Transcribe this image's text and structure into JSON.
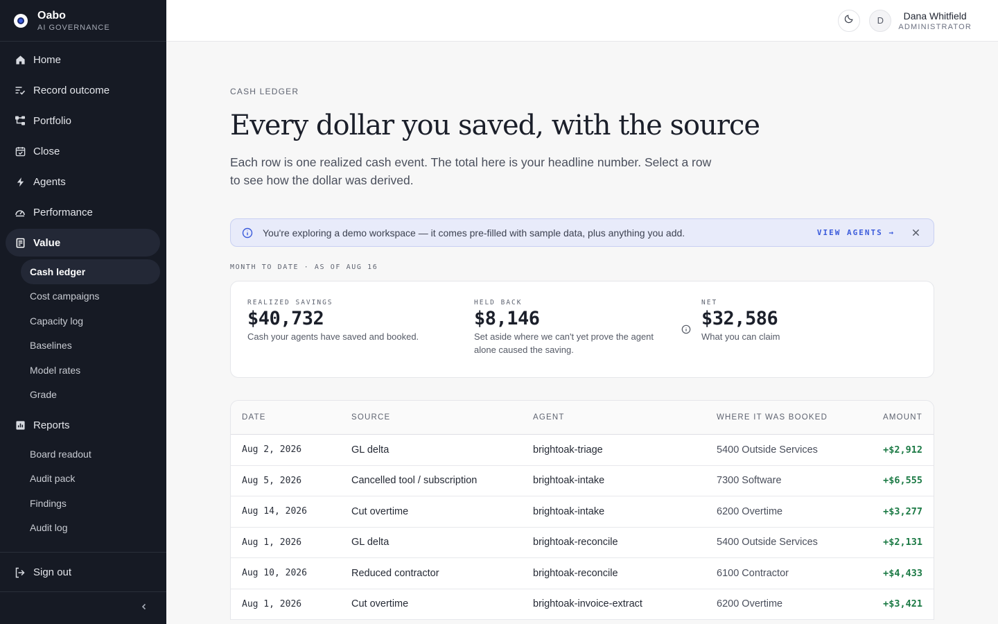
{
  "brand": {
    "name": "Oabo",
    "subtitle": "AI GOVERNANCE"
  },
  "nav": {
    "home": "Home",
    "record_outcome": "Record outcome",
    "portfolio": "Portfolio",
    "close": "Close",
    "agents": "Agents",
    "performance": "Performance",
    "value": "Value",
    "value_items": [
      "Cash ledger",
      "Cost campaigns",
      "Capacity log",
      "Baselines",
      "Model rates",
      "Grade"
    ],
    "reports": "Reports",
    "report_items": [
      "Board readout",
      "Audit pack",
      "Findings",
      "Audit log"
    ],
    "sign_out": "Sign out"
  },
  "user": {
    "initial": "D",
    "name": "Dana Whitfield",
    "role": "ADMINISTRATOR"
  },
  "page": {
    "eyebrow": "CASH LEDGER",
    "title": "Every dollar you saved, with the source",
    "lede": "Each row is one realized cash event. The total here is your headline number. Select a row to see how the dollar was derived."
  },
  "banner": {
    "text": "You're exploring a demo workspace — it comes pre-filled with sample data, plus anything you add.",
    "link": "VIEW AGENTS →"
  },
  "period": "MONTH TO DATE · AS OF AUG 16",
  "summary": {
    "realized": {
      "label": "REALIZED SAVINGS",
      "value": "$40,732",
      "desc": "Cash your agents have saved and booked."
    },
    "held": {
      "label": "HELD BACK",
      "value": "$8,146",
      "desc": "Set aside where we can't yet prove the agent alone caused the saving."
    },
    "net": {
      "label": "NET",
      "value": "$32,586",
      "desc": "What you can claim"
    }
  },
  "table": {
    "headers": {
      "date": "DATE",
      "source": "SOURCE",
      "agent": "AGENT",
      "booked": "WHERE IT WAS BOOKED",
      "amount": "AMOUNT"
    },
    "rows": [
      {
        "date": "Aug 2, 2026",
        "source": "GL delta",
        "agent": "brightoak-triage",
        "booked": "5400 Outside Services",
        "amount": "+$2,912"
      },
      {
        "date": "Aug 5, 2026",
        "source": "Cancelled tool / subscription",
        "agent": "brightoak-intake",
        "booked": "7300 Software",
        "amount": "+$6,555"
      },
      {
        "date": "Aug 14, 2026",
        "source": "Cut overtime",
        "agent": "brightoak-intake",
        "booked": "6200 Overtime",
        "amount": "+$3,277"
      },
      {
        "date": "Aug 1, 2026",
        "source": "GL delta",
        "agent": "brightoak-reconcile",
        "booked": "5400 Outside Services",
        "amount": "+$2,131"
      },
      {
        "date": "Aug 10, 2026",
        "source": "Reduced contractor",
        "agent": "brightoak-reconcile",
        "booked": "6100 Contractor",
        "amount": "+$4,433"
      },
      {
        "date": "Aug 1, 2026",
        "source": "Cut overtime",
        "agent": "brightoak-invoice-extract",
        "booked": "6200 Overtime",
        "amount": "+$3,421"
      }
    ]
  },
  "colors": {
    "sidebar": "#161a24",
    "accent": "#3b5bdb",
    "positive": "#1c7a45"
  },
  "icons": [
    "home-icon",
    "record-outcome-icon",
    "portfolio-icon",
    "calendar-check-icon",
    "bolt-icon",
    "gauge-icon",
    "ledger-icon",
    "bar-chart-icon",
    "sign-out-icon",
    "chevron-left-icon",
    "moon-icon",
    "info-icon",
    "close-icon"
  ]
}
